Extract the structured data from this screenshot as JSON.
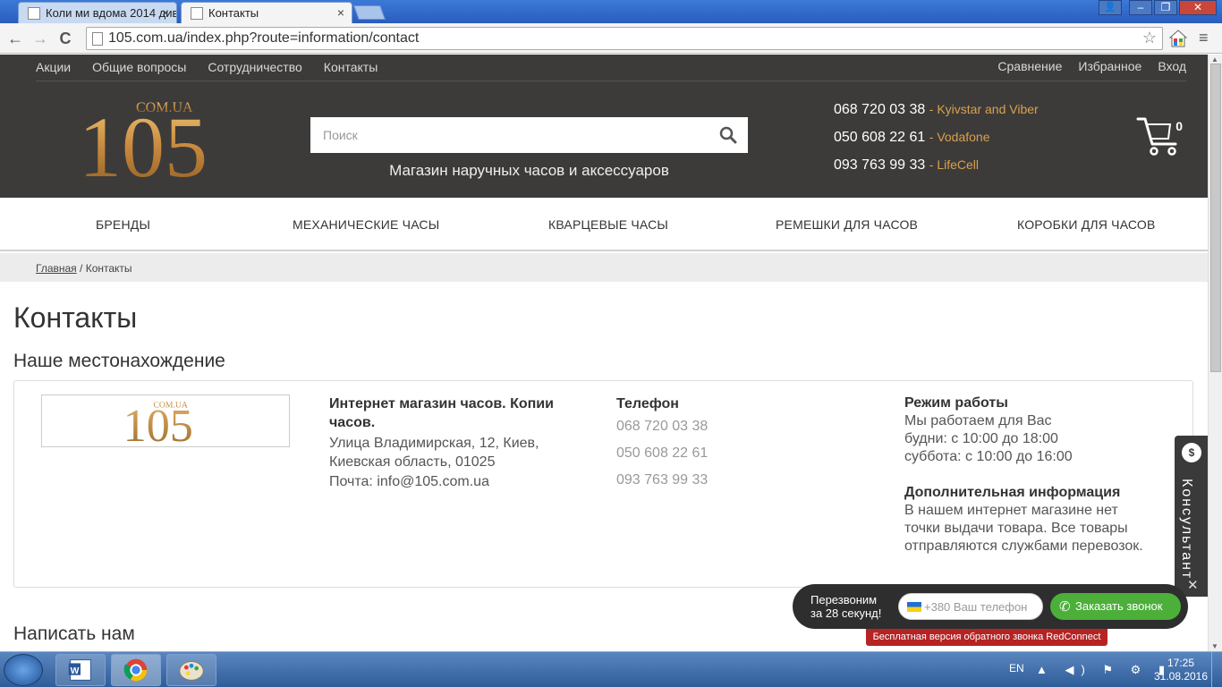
{
  "browser": {
    "tabs": [
      {
        "title": "Коли ми вдома 2014 див"
      },
      {
        "title": "Контакты"
      }
    ],
    "url": "105.com.ua/index.php?route=information/contact",
    "back": "←",
    "forward": "→",
    "reload": "C",
    "star": "☆",
    "menu": "≡",
    "win_minimize": "–",
    "win_restore": "❐",
    "win_close": "✕",
    "user": "👤"
  },
  "header": {
    "topnav": [
      "Акции",
      "Общие вопросы",
      "Сотрудничество",
      "Контакты"
    ],
    "topnav_right": [
      "Сравнение",
      "Избранное",
      "Вход"
    ],
    "logo": {
      "main": "105",
      "sub": "COM.UA"
    },
    "search_placeholder": "Поиск",
    "slogan": "Магазин наручных часов и аксессуаров",
    "phones": [
      {
        "number": "068 720 03 38",
        "operator": "- Kyivstar and Viber"
      },
      {
        "number": "050 608 22 61",
        "operator": "- Vodafone"
      },
      {
        "number": "093 763 99 33",
        "operator": "- LifeCell"
      }
    ],
    "cart_count": "0",
    "accent_color": "#d9a14d"
  },
  "mainnav": [
    "БРЕНДЫ",
    "МЕХАНИЧЕСКИЕ ЧАСЫ",
    "КВАРЦЕВЫЕ ЧАСЫ",
    "РЕМЕШКИ ДЛЯ ЧАСОВ",
    "КОРОБКИ ДЛЯ ЧАСОВ"
  ],
  "breadcrumb": {
    "home": "Главная",
    "sep": " / ",
    "current": "Контакты"
  },
  "content": {
    "title": "Контакты",
    "location_heading": "Наше местонахождение",
    "store_name": "Интернет магазин часов. Копии часов.",
    "address": "Улица Владимирская, 12, Киев, Киевская область, 01025",
    "email": "Почта: info@105.com.ua",
    "phone_heading": "Телефон",
    "phones": [
      "068 720 03 38",
      "050 608 22 61",
      "093 763 99 33"
    ],
    "hours_heading": "Режим работы",
    "hours": [
      "Мы работаем для Вас",
      "будни: с 10:00 до 18:00",
      "суббота: с 10:00 до 16:00"
    ],
    "extra_heading": "Дополнительная информация",
    "extra_text": "В нашем интернет магазине нет точки выдачи товара. Все товары отправляются службами перевозок.",
    "write_heading": "Написать нам"
  },
  "consultant": {
    "label": "Консультант",
    "icon": "$",
    "close": "✕"
  },
  "callback": {
    "text_line1": "Перезвоним",
    "text_line2": "за 28 секунд!",
    "input_placeholder": "+380 Ваш телефон",
    "button_label": "Заказать звонок",
    "footer": "Бесплатная версия обратного звонка RedConnect",
    "button_color": "#4caf3a"
  },
  "taskbar": {
    "lang": "EN",
    "time": "17:25",
    "date": "31.08.2016",
    "tray_icons": "▲ ◀) ⚑ ⚙ ▮"
  }
}
